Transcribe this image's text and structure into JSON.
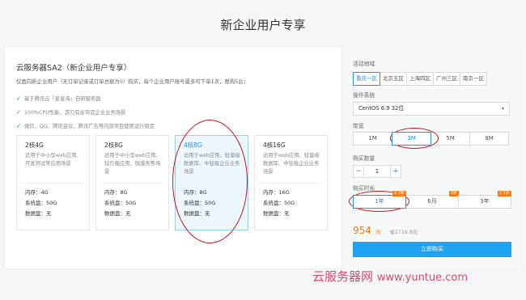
{
  "header": {
    "title": "新企业用户专享"
  },
  "product": {
    "title": "云服务器SA2（新企业用户专享）",
    "description": "仅面向新企业用户（无订单记录或订单总额为0）购买，每个企业用户账号最多可下单1次，限购5台；",
    "features": [
      "基于腾讯云「星星海」自研服务器",
      "100%CPU性能，游刃有余驾驭企业业务场景",
      "微信、QQ、腾讯会议、腾讯广告等内部项目使用运行稳定"
    ]
  },
  "cards": [
    {
      "config": "2核4G",
      "desc": "适用于中小型web应用、开发测试等应用场景",
      "memory": "内存：4G",
      "system_disk": "系统盘：50G",
      "data_disk": "数据盘：无"
    },
    {
      "config": "2核8G",
      "desc": "适用于中小型web应用、轻负载应用、微服务等场景",
      "memory": "内存：8G",
      "system_disk": "系统盘：50G",
      "data_disk": "数据盘：无"
    },
    {
      "config": "4核8G",
      "desc": "适用于web应用、轻量级数据库、中轻载企业业务场景",
      "memory": "内存：8G",
      "system_disk": "系统盘：50G",
      "data_disk": "数据盘：无"
    },
    {
      "config": "4核16G",
      "desc": "适用于web应用、轻量级数据库、中轻载企业业务场景",
      "memory": "内存：16G",
      "system_disk": "系统盘：50G",
      "data_disk": "数据盘：无"
    }
  ],
  "selected_card": "4核8G",
  "config_panel": {
    "region_label": "活动地域",
    "regions": [
      "重庆一区",
      "北京五区",
      "上海四区",
      "广州三区",
      "南京一区"
    ],
    "selected_region": "重庆一区",
    "os_label": "操作系统",
    "os_value": "CentOS 6.9 32位",
    "bandwidth_label": "带宽",
    "bandwidths": [
      "1M",
      "3M",
      "5M",
      "8M"
    ],
    "selected_bandwidth": "3M",
    "quantity_label": "购买数量",
    "quantity_minus": "−",
    "quantity_value": "1",
    "quantity_plus": "+",
    "duration_label": "购买时长",
    "durations": [
      {
        "label": "1年",
        "badge": "2.3折"
      },
      {
        "label": "6月",
        "badge": "3折"
      },
      {
        "label": "3年",
        "badge": "2.1折"
      }
    ],
    "selected_duration": "1年",
    "price": "954",
    "price_unit": "元",
    "original_price": "省2716.8元",
    "buy_label": "立即购买"
  },
  "watermark": {
    "cn": "云服务器网",
    "url": "www.yuntue.com"
  },
  "colors": {
    "accent": "#2d8cf0",
    "price": "#ff7a14",
    "buy_button": "#1ea2f2",
    "annotation": "#c6131b"
  }
}
